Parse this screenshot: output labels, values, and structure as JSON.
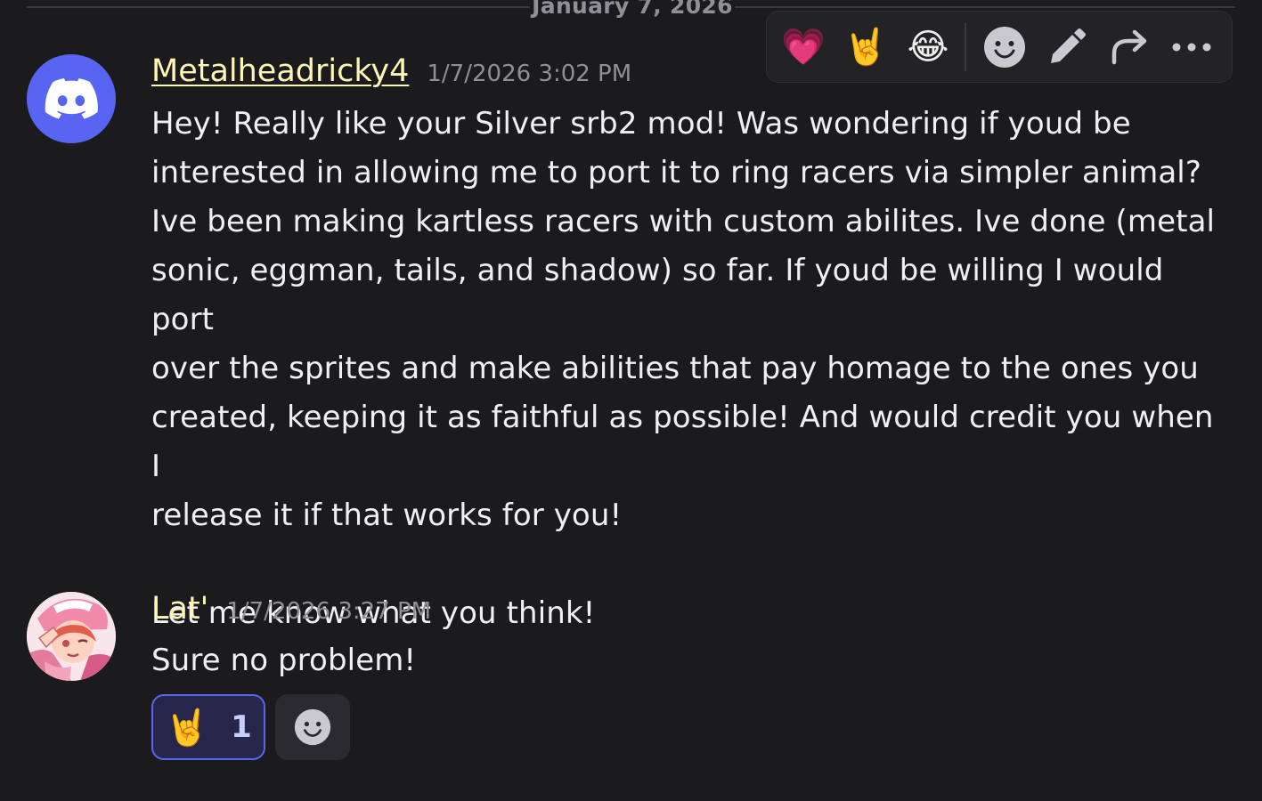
{
  "date_divider": "January 7, 2026",
  "toolbar": {
    "reactions": [
      {
        "emoji": "💗",
        "name": "heart"
      },
      {
        "emoji": "🤘",
        "name": "metal"
      },
      {
        "emoji": "😂",
        "name": "joy"
      }
    ],
    "icons": [
      "add-reaction-icon",
      "edit-icon",
      "forward-icon",
      "more-icon"
    ]
  },
  "messages": [
    {
      "author": "Metalheadricky4",
      "timestamp": "1/7/2026 3:02 PM",
      "avatar": "discord-default-avatar",
      "body": "Hey! Really like your Silver srb2 mod! Was wondering if youd be\ninterested in allowing me to port it to ring racers via simpler animal?\nIve been making kartless racers with custom abilites. Ive done (metal\nsonic, eggman, tails, and shadow) so far. If youd be willing I would port\nover the sprites and make abilities that pay homage to the ones you\ncreated, keeping it as faithful as possible! And would credit you when I\nrelease it if that works for you!\n\nLet me know what you think!"
    },
    {
      "author": "Lat'",
      "timestamp": "1/7/2026 3:27 PM",
      "avatar": "user-avatar",
      "body": "Sure no problem!",
      "reactions": [
        {
          "emoji": "🤘",
          "count": "1",
          "selected": true
        }
      ]
    }
  ],
  "colors": {
    "background": "#1b1b1d",
    "username": "#fdf6b6",
    "timestamp": "#8f8f96",
    "accent": "#5865f2"
  }
}
